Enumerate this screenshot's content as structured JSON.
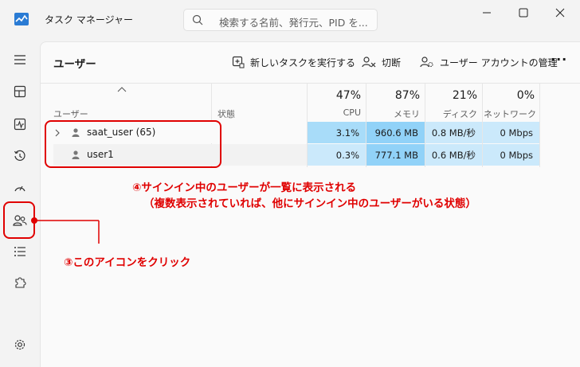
{
  "window": {
    "title": "タスク マネージャー",
    "search_placeholder": "検索する名前、発行元、PID を..."
  },
  "page": {
    "title": "ユーザー",
    "toolbar": {
      "new_task": "新しいタスクを実行する",
      "disconnect": "切断",
      "manage_accounts": "ユーザー アカウントの管理",
      "more": "···"
    }
  },
  "columns": {
    "user": "ユーザー",
    "status": "状態",
    "cpu": {
      "pct": "47%",
      "label": "CPU"
    },
    "memory": {
      "pct": "87%",
      "label": "メモリ"
    },
    "disk": {
      "pct": "21%",
      "label": "ディスク"
    },
    "network": {
      "pct": "0%",
      "label": "ネットワーク"
    }
  },
  "rows": [
    {
      "name": "saat_user (65)",
      "status": "",
      "cpu": "3.1%",
      "memory": "960.6 MB",
      "disk": "0.8 MB/秒",
      "network": "0 Mbps"
    },
    {
      "name": "user1",
      "status": "",
      "cpu": "0.3%",
      "memory": "777.1 MB",
      "disk": "0.6 MB/秒",
      "network": "0 Mbps"
    }
  ],
  "annotations": {
    "line1": "④サインイン中のユーザーが一覧に表示される",
    "line2": "（複数表示されていれば、他にサインイン中のユーザーがいる状態）",
    "click": "③このアイコンをクリック"
  },
  "colors": {
    "annotation": "#e00000",
    "heat_light": "#cbe9fb",
    "heat_mid": "#a8dcf9",
    "heat_strong": "#91d2f8"
  }
}
